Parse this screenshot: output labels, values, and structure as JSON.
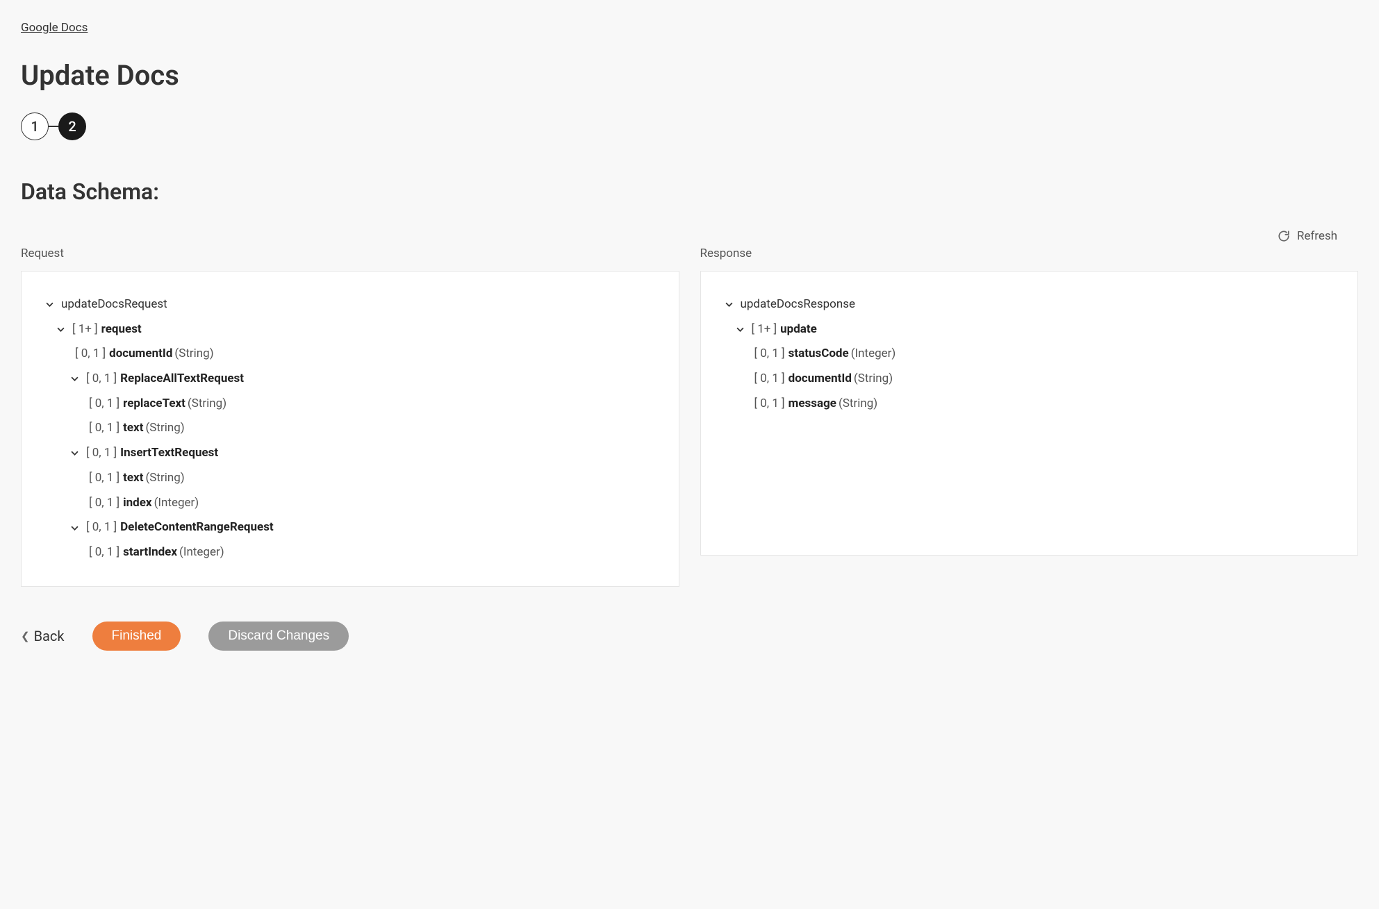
{
  "breadcrumb": "Google Docs",
  "title": "Update Docs",
  "steps": [
    "1",
    "2"
  ],
  "section_title": "Data Schema:",
  "refresh_label": "Refresh",
  "request_label": "Request",
  "response_label": "Response",
  "request": {
    "root": "updateDocsRequest",
    "items": [
      {
        "card": "[ 1+ ]",
        "name": "request",
        "type": ""
      },
      {
        "card": "[ 0, 1 ]",
        "name": "documentId",
        "type": "(String)"
      },
      {
        "card": "[ 0, 1 ]",
        "name": "ReplaceAllTextRequest",
        "type": ""
      },
      {
        "card": "[ 0, 1 ]",
        "name": "replaceText",
        "type": "(String)"
      },
      {
        "card": "[ 0, 1 ]",
        "name": "text",
        "type": "(String)"
      },
      {
        "card": "[ 0, 1 ]",
        "name": "InsertTextRequest",
        "type": ""
      },
      {
        "card": "[ 0, 1 ]",
        "name": "text",
        "type": "(String)"
      },
      {
        "card": "[ 0, 1 ]",
        "name": "index",
        "type": "(Integer)"
      },
      {
        "card": "[ 0, 1 ]",
        "name": "DeleteContentRangeRequest",
        "type": ""
      },
      {
        "card": "[ 0, 1 ]",
        "name": "startIndex",
        "type": "(Integer)"
      }
    ]
  },
  "response": {
    "root": "updateDocsResponse",
    "items": [
      {
        "card": "[ 1+ ]",
        "name": "update",
        "type": ""
      },
      {
        "card": "[ 0, 1 ]",
        "name": "statusCode",
        "type": "(Integer)"
      },
      {
        "card": "[ 0, 1 ]",
        "name": "documentId",
        "type": "(String)"
      },
      {
        "card": "[ 0, 1 ]",
        "name": "message",
        "type": "(String)"
      }
    ]
  },
  "footer": {
    "back": "Back",
    "finished": "Finished",
    "discard": "Discard Changes"
  }
}
